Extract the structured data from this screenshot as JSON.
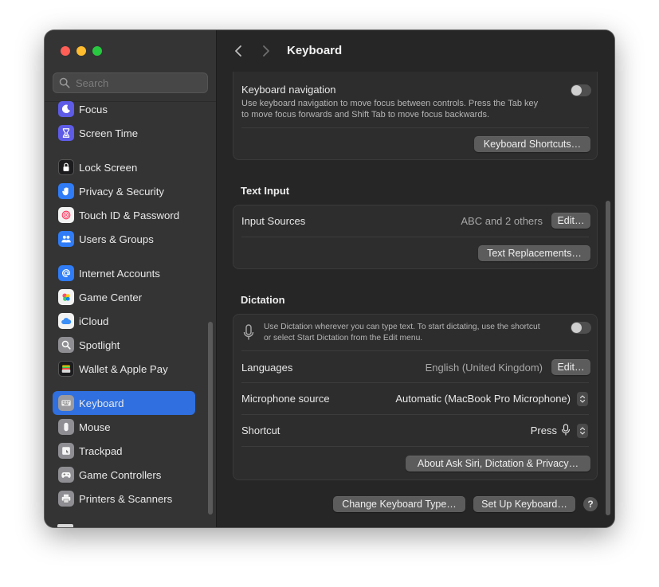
{
  "sidebar": {
    "search_placeholder": "Search",
    "items": [
      {
        "label": "Focus",
        "icon": "moon-icon",
        "color": "#5e5ce6",
        "selected": false
      },
      {
        "label": "Screen Time",
        "icon": "hourglass-icon",
        "color": "#5e5ce6",
        "selected": false
      },
      {
        "label": "Lock Screen",
        "icon": "lock-icon",
        "color": "#1c1c1e",
        "selected": false
      },
      {
        "label": "Privacy & Security",
        "icon": "hand-icon",
        "color": "#2f7cf6",
        "selected": false
      },
      {
        "label": "Touch ID & Password",
        "icon": "fingerprint-icon",
        "color": "#f2f2f2",
        "selected": false
      },
      {
        "label": "Users & Groups",
        "icon": "users-icon",
        "color": "#2f7cf6",
        "selected": false
      },
      {
        "label": "Internet Accounts",
        "icon": "at-icon",
        "color": "#2f7cf6",
        "selected": false
      },
      {
        "label": "Game Center",
        "icon": "game-center-icon",
        "color": "#f2f2f2",
        "selected": false
      },
      {
        "label": "iCloud",
        "icon": "cloud-icon",
        "color": "#f2f2f2",
        "selected": false
      },
      {
        "label": "Spotlight",
        "icon": "magnifier-icon",
        "color": "#8e8e93",
        "selected": false
      },
      {
        "label": "Wallet & Apple Pay",
        "icon": "wallet-icon",
        "color": "#1c1c1e",
        "selected": false
      },
      {
        "label": "Keyboard",
        "icon": "keyboard-icon",
        "color": "#8e8e93",
        "selected": true
      },
      {
        "label": "Mouse",
        "icon": "mouse-icon",
        "color": "#8e8e93",
        "selected": false
      },
      {
        "label": "Trackpad",
        "icon": "trackpad-icon",
        "color": "#8e8e93",
        "selected": false
      },
      {
        "label": "Game Controllers",
        "icon": "gamepad-icon",
        "color": "#8e8e93",
        "selected": false
      },
      {
        "label": "Printers & Scanners",
        "icon": "printer-icon",
        "color": "#8e8e93",
        "selected": false
      }
    ]
  },
  "toolbar": {
    "title": "Keyboard",
    "back_icon": "chevron-left-icon",
    "forward_icon": "chevron-right-icon"
  },
  "keyboard_nav": {
    "label": "Keyboard navigation",
    "description_line1": "Use keyboard navigation to move focus between controls. Press the Tab key",
    "description_line2": "to move focus forwards and Shift Tab to move focus backwards.",
    "enabled": false,
    "shortcuts_button": "Keyboard Shortcuts…"
  },
  "text_input": {
    "title": "Text Input",
    "input_sources_label": "Input Sources",
    "input_sources_value": "ABC and 2 others",
    "edit_button": "Edit…",
    "replacements_button": "Text Replacements…"
  },
  "dictation": {
    "title": "Dictation",
    "description_line1": "Use Dictation wherever you can type text. To start dictating, use the shortcut",
    "description_line2": "or select Start Dictation from the Edit menu.",
    "enabled": false,
    "languages_label": "Languages",
    "languages_value": "English (United Kingdom)",
    "languages_edit": "Edit…",
    "mic_label": "Microphone source",
    "mic_value": "Automatic (MacBook Pro Microphone)",
    "shortcut_label": "Shortcut",
    "shortcut_value": "Press",
    "about_button": "About Ask Siri, Dictation & Privacy…"
  },
  "footer": {
    "change_type_button": "Change Keyboard Type…",
    "setup_button": "Set Up Keyboard…",
    "help_label": "?"
  }
}
